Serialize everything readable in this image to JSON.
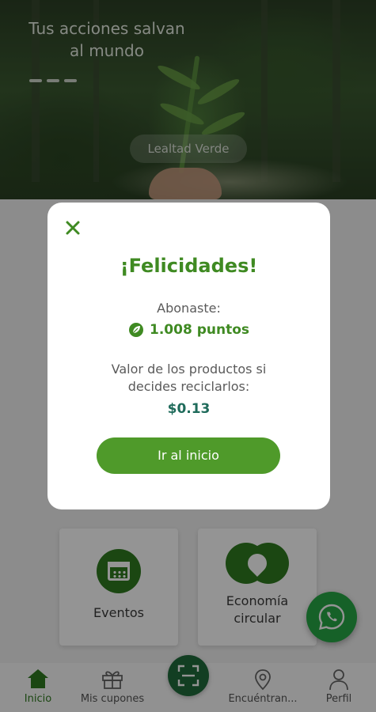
{
  "hero": {
    "title_line1": "Tus acciones salvan",
    "title_line2": "al mundo",
    "chip_label": "Lealtad Verde"
  },
  "cards": {
    "events_label": "Eventos",
    "circular_line1": "Economía",
    "circular_line2": "circular"
  },
  "bottom_nav": {
    "items": [
      {
        "label": "Inicio",
        "icon": "home-icon",
        "active": true
      },
      {
        "label": "Mis cupones",
        "icon": "gift-icon",
        "active": false
      },
      {
        "label": "Encuéntran...",
        "icon": "location-icon",
        "active": false
      },
      {
        "label": "Perfil",
        "icon": "user-icon",
        "active": false
      }
    ],
    "scan_icon": "scan-icon"
  },
  "fab": {
    "icon": "whatsapp-icon"
  },
  "dialog": {
    "title": "¡Felicidades!",
    "credited_label": "Abonaste:",
    "points": "1.008 puntos",
    "value_line1": "Valor de los productos si",
    "value_line2": "decides reciclarlos:",
    "value": "$0.13",
    "button_label": "Ir al inicio"
  },
  "colors": {
    "brand_green": "#3f8a22",
    "button_green": "#4f9a2a",
    "whatsapp_green": "#27a745",
    "value_teal": "#1f6b5b"
  }
}
